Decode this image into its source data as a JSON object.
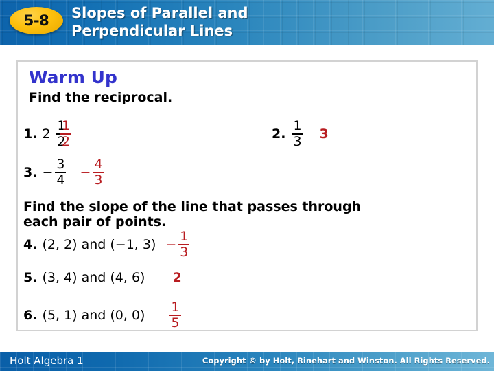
{
  "header": {
    "badge": "5-8",
    "title_line1": "Slopes of Parallel and",
    "title_line2": "Perpendicular Lines",
    "badge_color": "#fdc00d",
    "bg_color_left": "#0d63ab",
    "bg_color_right": "#63aed3"
  },
  "content": {
    "section_title": "Warm Up",
    "section_title_color": "#3333cc",
    "instruction_1": "Find the reciprocal.",
    "instruction_2_line1": "Find the slope of the line that passes through",
    "instruction_2_line2": "each pair of points.",
    "answer_color": "#b81c20",
    "problems": [
      {
        "number": "1.",
        "question_whole": "2",
        "question_num": "1",
        "question_den": "2",
        "question_sign": "",
        "answer_type": "fraction",
        "answer_sign": "",
        "answer_num": "1",
        "answer_den": "2"
      },
      {
        "number": "2.",
        "question_whole": "",
        "question_num": "1",
        "question_den": "3",
        "question_sign": "",
        "answer_type": "whole",
        "answer_sign": "",
        "answer_whole": "3"
      },
      {
        "number": "3.",
        "question_whole": "",
        "question_sign": "−",
        "question_num": "3",
        "question_den": "4",
        "answer_type": "fraction",
        "answer_sign": "−",
        "answer_num": "4",
        "answer_den": "3"
      },
      {
        "number": "4.",
        "question_text": "(2, 2) and (−1, 3)",
        "answer_type": "fraction",
        "answer_sign": "−",
        "answer_num": "1",
        "answer_den": "3"
      },
      {
        "number": "5.",
        "question_text": "(3, 4) and (4, 6)",
        "answer_type": "whole",
        "answer_sign": "",
        "answer_whole": "2"
      },
      {
        "number": "6.",
        "question_text": "(5, 1) and (0, 0)",
        "answer_type": "fraction",
        "answer_sign": "",
        "answer_num": "1",
        "answer_den": "5"
      }
    ]
  },
  "footer": {
    "left_text": "Holt Algebra 1",
    "right_text": "Copyright © by Holt, Rinehart and Winston. All Rights Reserved."
  }
}
